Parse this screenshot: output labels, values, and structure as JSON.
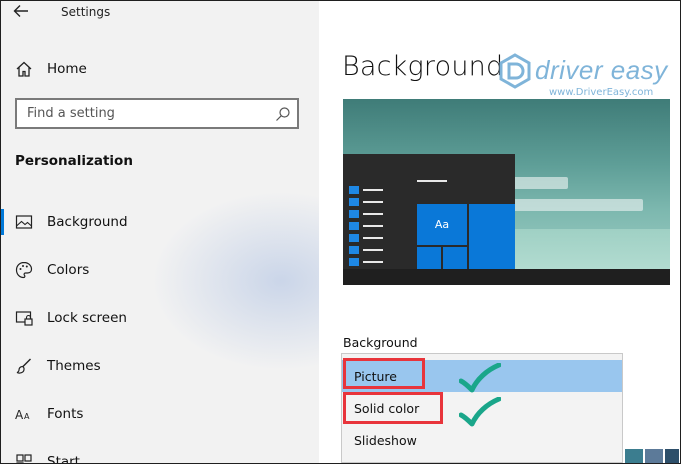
{
  "window": {
    "title": "Settings"
  },
  "sidebar": {
    "home_label": "Home",
    "search_placeholder": "Find a setting",
    "section": "Personalization",
    "items": [
      {
        "label": "Background",
        "icon": "picture-icon",
        "selected": true
      },
      {
        "label": "Colors",
        "icon": "palette-icon"
      },
      {
        "label": "Lock screen",
        "icon": "lock-screen-icon"
      },
      {
        "label": "Themes",
        "icon": "brush-icon"
      },
      {
        "label": "Fonts",
        "icon": "fonts-icon"
      },
      {
        "label": "Start",
        "icon": "start-icon"
      }
    ]
  },
  "main": {
    "title": "Background",
    "preview_tile": "Aa",
    "background_label": "Background",
    "dropdown_options": [
      {
        "label": "Picture",
        "selected": true
      },
      {
        "label": "Solid color"
      },
      {
        "label": "Slideshow"
      }
    ]
  },
  "watermark": {
    "brand": "driver easy",
    "url": "www.DriverEasy.com"
  },
  "colors": {
    "accent": "#0078d7",
    "selected_option": "#99c6ee",
    "highlight": "#e8343b",
    "check": "#1aa68a"
  }
}
